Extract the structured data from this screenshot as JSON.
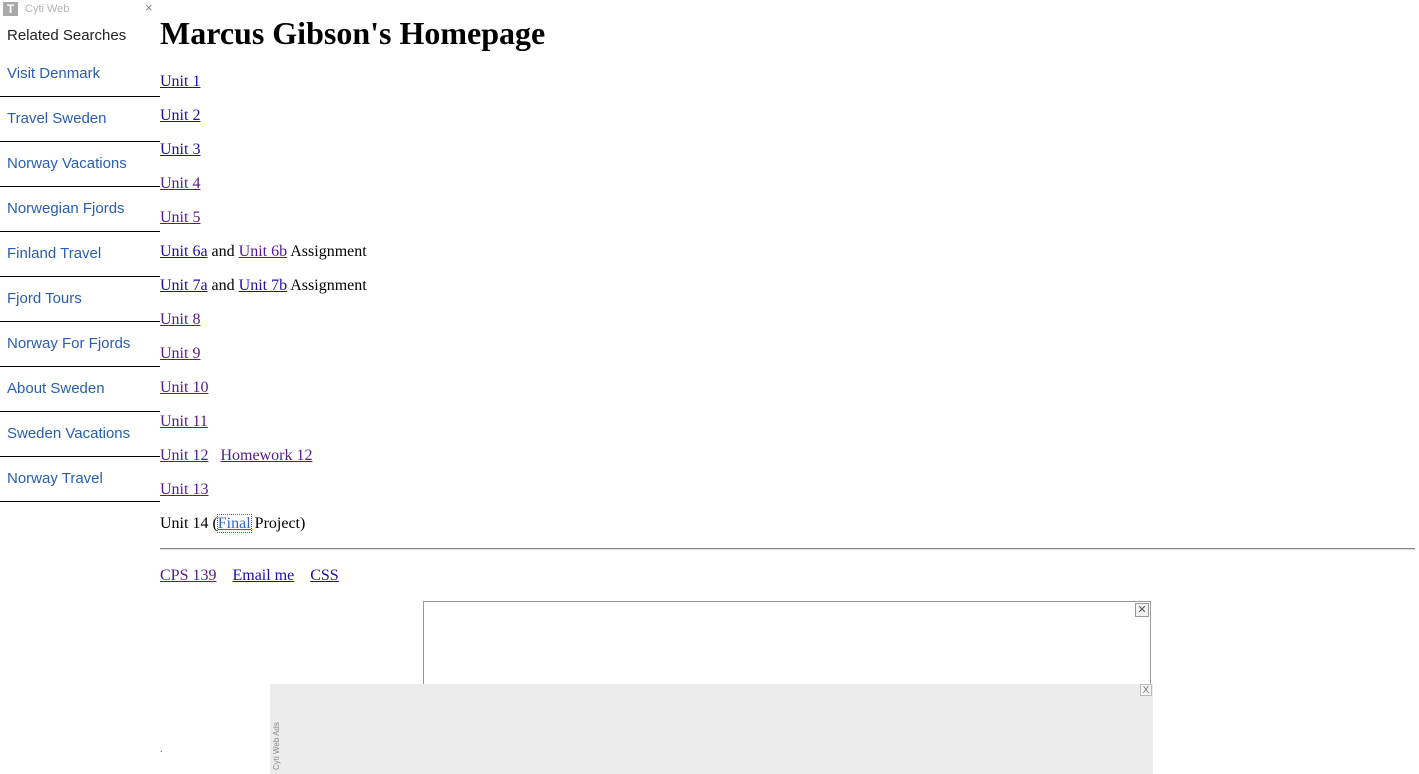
{
  "sidebar": {
    "logo_letter": "T",
    "brand": "Cyti Web",
    "close": "×",
    "heading": "Related Searches",
    "items": [
      {
        "label": "Visit Denmark"
      },
      {
        "label": "Travel Sweden"
      },
      {
        "label": "Norway Vacations"
      },
      {
        "label": "Norwegian Fjords"
      },
      {
        "label": "Finland Travel"
      },
      {
        "label": "Fjord Tours"
      },
      {
        "label": "Norway For Fjords"
      },
      {
        "label": "About Sweden"
      },
      {
        "label": "Sweden Vacations"
      },
      {
        "label": "Norway Travel"
      }
    ]
  },
  "main": {
    "title": "Marcus Gibson's Homepage",
    "units": {
      "u1": "Unit 1",
      "u2": "Unit 2",
      "u3": "Unit 3",
      "u4": "Unit 4",
      "u5": "Unit 5",
      "u6a": "Unit 6a",
      "u6_and": "and",
      "u6b": "Unit 6b",
      "u6_suffix": "Assignment",
      "u7a": "Unit 7a",
      "u7_and": "and",
      "u7b": "Unit 7b",
      "u7_suffix": "Assignment",
      "u8": "Unit 8",
      "u9": "Unit 9",
      "u10": "Unit 10",
      "u11": "Unit 11",
      "u12": "Unit 12",
      "hw12": "Homework 12",
      "u13": "Unit 13",
      "u14_prefix": "Unit 14 (",
      "u14_final": "Final",
      "u14_suffix": " Project)"
    },
    "footer": {
      "cps": "CPS 139",
      "email": "Email me",
      "css": "CSS"
    }
  },
  "ads": {
    "box_close": "✕",
    "bar_label": "Cyti Web Ads",
    "bar_close": "X",
    "dot": "."
  }
}
